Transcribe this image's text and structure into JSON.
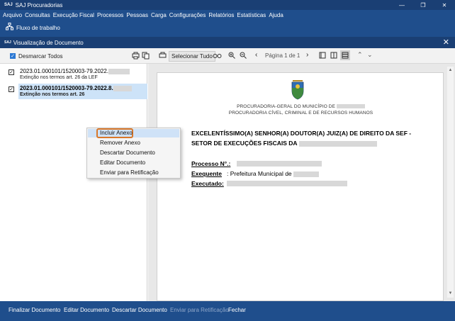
{
  "window": {
    "logo": "SAJ",
    "title": "SAJ Procuradorias",
    "controls": [
      "—",
      "❐",
      "✕"
    ]
  },
  "menubar": {
    "items": [
      "Arquivo",
      "Consultas",
      "Execução Fiscal",
      "Processos",
      "Pessoas",
      "Carga",
      "Configurações",
      "Relatórios",
      "Estatísticas",
      "Ajuda"
    ]
  },
  "top_toolbar": {
    "workflow_label": "Fluxo de trabalho",
    "workflow_icon": "workflow-icon"
  },
  "dialog": {
    "logo": "SAJ",
    "title": "Visualização de Documento",
    "close": "✕"
  },
  "dialog_toolbar": {
    "deselect_all_label": "Desmarcar Todos",
    "select_all_label": "Selecionar Tudo",
    "page_label": "Página 1 de 1"
  },
  "documents": [
    {
      "number": "2023.01.000101/1520003-79.2022.",
      "description": "Extinção nos termos art. 26 da LEF",
      "checked": true,
      "selected": false
    },
    {
      "number": "2023.01.000101/1520003-79.2022.8.",
      "description": "Extinção nos termos art. 26",
      "checked": true,
      "selected": true
    }
  ],
  "context_menu": {
    "items": [
      "Incluir Anexo",
      "Remover Anexo",
      "Descartar Documento",
      "Editar Documento",
      "Enviar para Retificação"
    ]
  },
  "preview": {
    "org_line1": "PROCURADORIA-GERAL DO MUNICÍPIO DE",
    "org_line2": "PROCURADORIA CÍVEL, CRIMINAL E DE RECURSOS HUMANOS",
    "greeting_line1": "EXCELENTÍSSIMO(A) SENHOR(A) DOUTOR(A) JUIZ(A) DE DIREITO DA SEF -",
    "greeting_line2": "SETOR DE EXECUÇÕES FISCAIS DA",
    "processo_label": "Processo N°.:",
    "exequente_label": "Exequente",
    "exequente_value": ": Prefeitura Municipal de",
    "executado_label": "Executado:"
  },
  "bottom_bar": {
    "finalize": "Finalizar Documento",
    "edit": "Editar Documento",
    "discard": "Descartar Documento",
    "send_rectify": "Enviar para Retificação",
    "close": "Fechar"
  },
  "colors": {
    "app_blue": "#1f4e8c",
    "title_blue": "#1a3f74",
    "selection": "#cde3f8",
    "highlight_ring": "#d9782a"
  }
}
